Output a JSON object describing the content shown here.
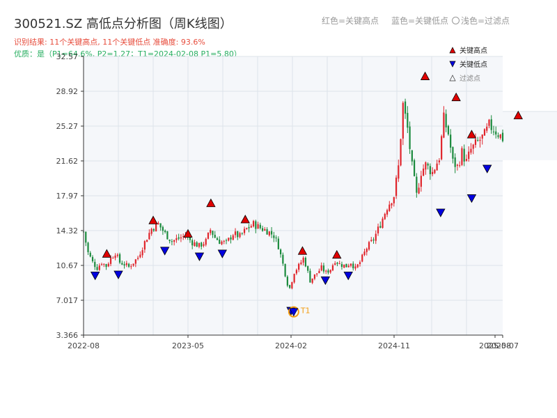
{
  "header": {
    "title": "300521.SZ 高低点分析图（周K线图）",
    "result_line": "识别结果: 11个关键高点, 11个关键低点   准确度: 93.6%",
    "quality_line": "优质：是（P1=64.6%, P2=1.27；T1=2024-02-08 P1=5.80）"
  },
  "top_legend": {
    "red": "红色=关键高点",
    "blue": "蓝色=关键低点",
    "light": "浅色=过滤点"
  },
  "colors": {
    "up": "#e0242b",
    "down": "#1a8a3c",
    "high_marker": "#e00000",
    "low_marker": "#0000e0",
    "t1": "#f39c12",
    "grid": "#dde3ea",
    "plot_bg": "#f5f7fa"
  },
  "chart_data": {
    "type": "candlestick",
    "ylim": [
      3.366,
      32.57
    ],
    "y_ticks": [
      "32.57",
      "28.92",
      "25.27",
      "21.62",
      "17.97",
      "14.32",
      "10.67",
      "7.017",
      "3.366"
    ],
    "y_tick_values": [
      32.57,
      28.92,
      25.27,
      21.62,
      17.97,
      14.32,
      10.67,
      7.017,
      3.366
    ],
    "x_ticks": [
      "2022-08",
      "2023-05",
      "2024-02",
      "2024-11",
      "2025-08",
      "2025-07"
    ],
    "grid": true,
    "legend": {
      "position": "top-right",
      "items": [
        {
          "label": "关键高点",
          "marker": "triangle-up",
          "color": "#e00000"
        },
        {
          "label": "关键低点",
          "marker": "triangle-down",
          "color": "#0000e0"
        },
        {
          "label": "过滤点",
          "marker": "triangle-up-outline",
          "color": "#999999"
        }
      ]
    },
    "key_highs": [
      {
        "date": "2022-10",
        "value": 11.3
      },
      {
        "date": "2023-02",
        "value": 14.8
      },
      {
        "date": "2023-05",
        "value": 13.4
      },
      {
        "date": "2023-07",
        "value": 16.6
      },
      {
        "date": "2023-10",
        "value": 14.9
      },
      {
        "date": "2024-03",
        "value": 11.6
      },
      {
        "date": "2024-06",
        "value": 11.2
      },
      {
        "date": "2025-01",
        "value": 29.9
      },
      {
        "date": "2025-03",
        "value": 27.7
      },
      {
        "date": "2025-04",
        "value": 23.8
      },
      {
        "date": "2025-07",
        "value": 25.8
      }
    ],
    "key_lows": [
      {
        "date": "2022-09",
        "value": 10.2
      },
      {
        "date": "2022-11",
        "value": 10.3
      },
      {
        "date": "2023-03",
        "value": 12.8
      },
      {
        "date": "2023-06",
        "value": 12.2
      },
      {
        "date": "2023-08",
        "value": 12.5
      },
      {
        "date": "2024-02",
        "value": 6.5
      },
      {
        "date": "2024-05",
        "value": 9.7
      },
      {
        "date": "2024-07",
        "value": 10.2
      },
      {
        "date": "2025-02",
        "value": 16.8
      },
      {
        "date": "2025-04",
        "value": 18.3
      },
      {
        "date": "2025-05",
        "value": 21.4
      }
    ],
    "t1": {
      "label": "T1",
      "date": "2024-02-08",
      "value": 5.8
    },
    "price_path": [
      [
        0,
        14.2
      ],
      [
        2,
        12.0
      ],
      [
        4,
        11.0
      ],
      [
        6,
        10.4
      ],
      [
        8,
        11.0
      ],
      [
        10,
        10.6
      ],
      [
        12,
        11.4
      ],
      [
        14,
        12.0
      ],
      [
        16,
        11.0
      ],
      [
        18,
        10.8
      ],
      [
        20,
        10.5
      ],
      [
        22,
        11.0
      ],
      [
        24,
        11.5
      ],
      [
        26,
        12.6
      ],
      [
        28,
        13.6
      ],
      [
        30,
        14.5
      ],
      [
        33,
        15.0
      ],
      [
        36,
        14.0
      ],
      [
        39,
        13.2
      ],
      [
        42,
        13.5
      ],
      [
        45,
        13.8
      ],
      [
        48,
        13.1
      ],
      [
        51,
        12.7
      ],
      [
        54,
        13.2
      ],
      [
        56,
        14.4
      ],
      [
        58,
        13.6
      ],
      [
        60,
        13.2
      ],
      [
        63,
        13.0
      ],
      [
        66,
        14.0
      ],
      [
        69,
        13.7
      ],
      [
        72,
        14.5
      ],
      [
        75,
        15.0
      ],
      [
        78,
        14.6
      ],
      [
        81,
        14.3
      ],
      [
        84,
        13.8
      ],
      [
        86,
        12.7
      ],
      [
        88,
        10.8
      ],
      [
        90,
        8.8
      ],
      [
        91,
        8.3
      ],
      [
        93,
        10.0
      ],
      [
        95,
        10.6
      ],
      [
        97,
        11.4
      ],
      [
        98,
        10.8
      ],
      [
        100,
        9.1
      ],
      [
        102,
        9.6
      ],
      [
        105,
        10.4
      ],
      [
        107,
        9.9
      ],
      [
        109,
        10.3
      ],
      [
        111,
        11.2
      ],
      [
        113,
        10.8
      ],
      [
        116,
        10.6
      ],
      [
        118,
        11.0
      ],
      [
        120,
        10.3
      ],
      [
        122,
        11.0
      ],
      [
        125,
        12.5
      ],
      [
        128,
        13.4
      ],
      [
        131,
        15.0
      ],
      [
        134,
        16.8
      ],
      [
        137,
        18.0
      ],
      [
        139,
        21.0
      ],
      [
        141,
        27.5
      ],
      [
        143,
        25.0
      ],
      [
        145,
        21.0
      ],
      [
        147,
        18.0
      ],
      [
        149,
        20.5
      ],
      [
        151,
        21.2
      ],
      [
        154,
        20.4
      ],
      [
        157,
        22.0
      ],
      [
        159,
        26.0
      ],
      [
        161,
        24.5
      ],
      [
        163,
        21.5
      ],
      [
        165,
        21.0
      ],
      [
        167,
        22.5
      ],
      [
        169,
        21.5
      ],
      [
        171,
        22.8
      ],
      [
        174,
        23.6
      ],
      [
        177,
        24.3
      ],
      [
        179,
        25.3
      ],
      [
        181,
        25.0
      ],
      [
        183,
        24.5
      ],
      [
        185,
        24.0
      ]
    ]
  }
}
